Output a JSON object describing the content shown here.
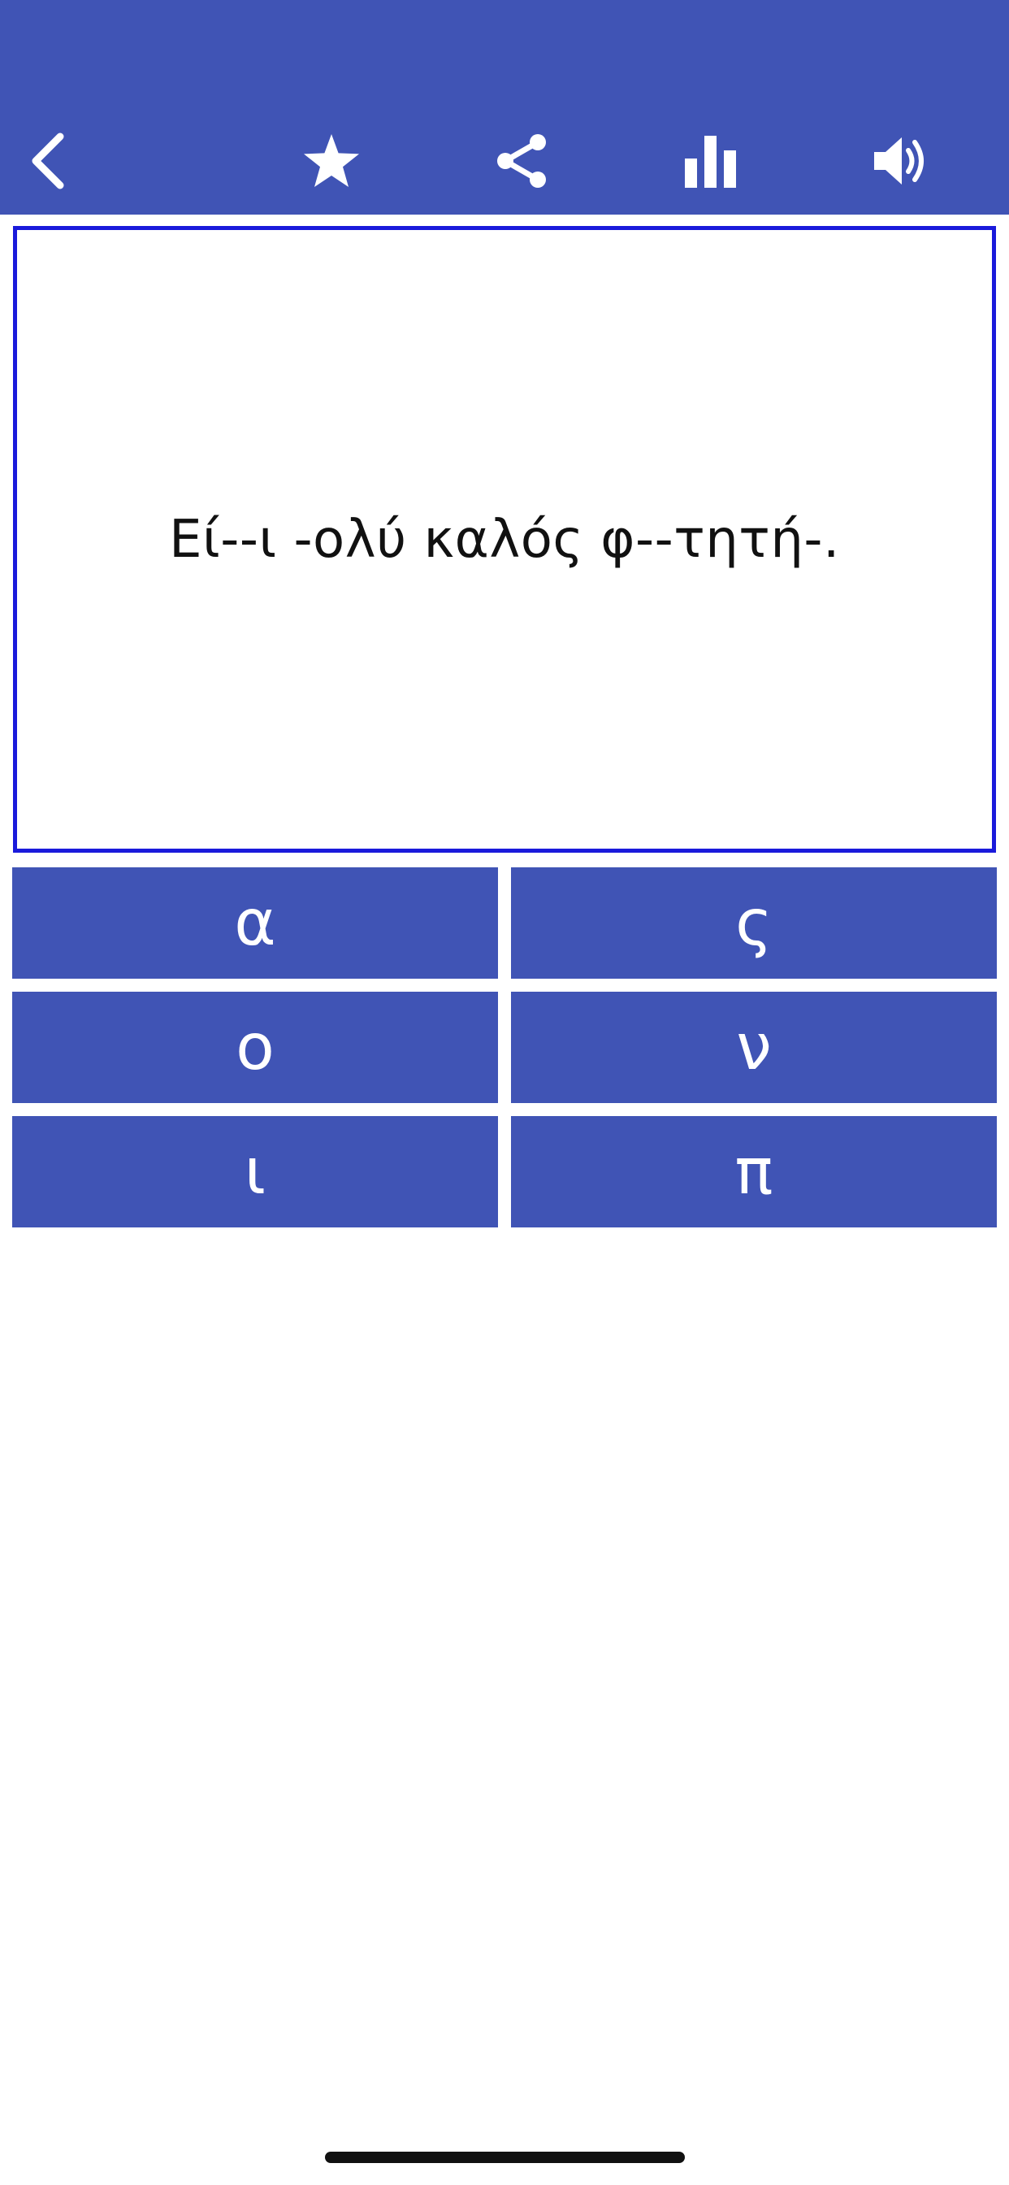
{
  "toolbar": {
    "background_color": "#4054b5",
    "buttons": [
      {
        "name": "back",
        "icon": "chevron-left-icon"
      },
      {
        "name": "favorite",
        "icon": "star-icon"
      },
      {
        "name": "share",
        "icon": "share-icon"
      },
      {
        "name": "statistics",
        "icon": "bar-chart-icon"
      },
      {
        "name": "sound",
        "icon": "speaker-icon"
      }
    ]
  },
  "exercise": {
    "sentence": "Εί--ι -ολύ καλός φ--τητή-.",
    "border_color": "#1a1adb"
  },
  "answers": [
    {
      "label": "α"
    },
    {
      "label": "ς"
    },
    {
      "label": "ο"
    },
    {
      "label": "ν"
    },
    {
      "label": "ι"
    },
    {
      "label": "π"
    }
  ],
  "colors": {
    "accent": "#4054b5",
    "text": "#111111",
    "button_text": "#ffffff"
  }
}
